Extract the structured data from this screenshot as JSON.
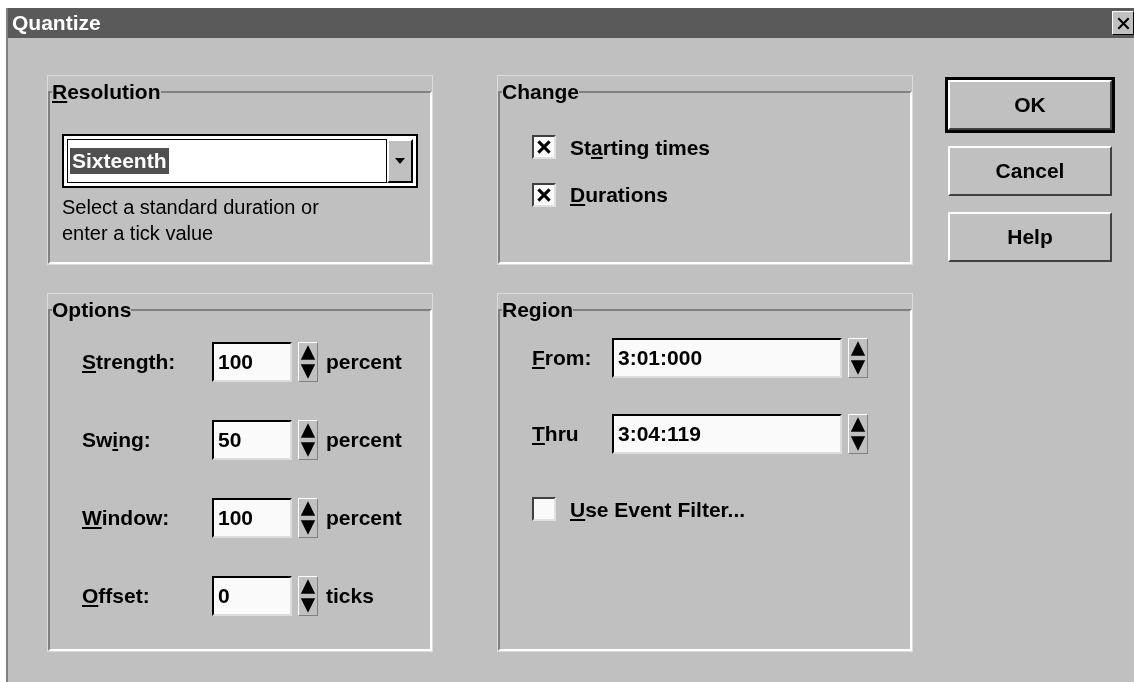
{
  "window": {
    "title": "Quantize"
  },
  "resolution": {
    "label": {
      "key": "R",
      "after": "esolution"
    },
    "value": "Sixteenth",
    "hint": "Select a standard duration or enter a tick value"
  },
  "change": {
    "label": "Change",
    "options": [
      {
        "label": {
          "before": "St",
          "key": "a",
          "after": "rting times"
        },
        "checked": true
      },
      {
        "label": {
          "key": "D",
          "after": "urations"
        },
        "checked": true
      }
    ]
  },
  "options": {
    "label": "Options",
    "rows": [
      {
        "label": {
          "key": "S",
          "after": "trength:"
        },
        "value": "100",
        "unit": "percent"
      },
      {
        "label": {
          "before": "Sw",
          "key": "i",
          "after": "ng:"
        },
        "value": "50",
        "unit": "percent"
      },
      {
        "label": {
          "key": "W",
          "after": "indow:"
        },
        "value": "100",
        "unit": "percent"
      },
      {
        "label": {
          "key": "O",
          "after": "ffset:"
        },
        "value": "0",
        "unit": "ticks"
      }
    ]
  },
  "region": {
    "label": "Region",
    "rows": [
      {
        "label": {
          "key": "F",
          "after": "rom:"
        },
        "value": "3:01:000"
      },
      {
        "label": {
          "key": "T",
          "after": "hru"
        },
        "value": "3:04:119"
      }
    ],
    "filter": {
      "label": {
        "key": "U",
        "after": "se Event Filter..."
      },
      "checked": false
    }
  },
  "buttons": [
    {
      "label": "OK",
      "default": true
    },
    {
      "label": "Cancel",
      "default": false
    },
    {
      "label": "Help",
      "default": false
    }
  ]
}
